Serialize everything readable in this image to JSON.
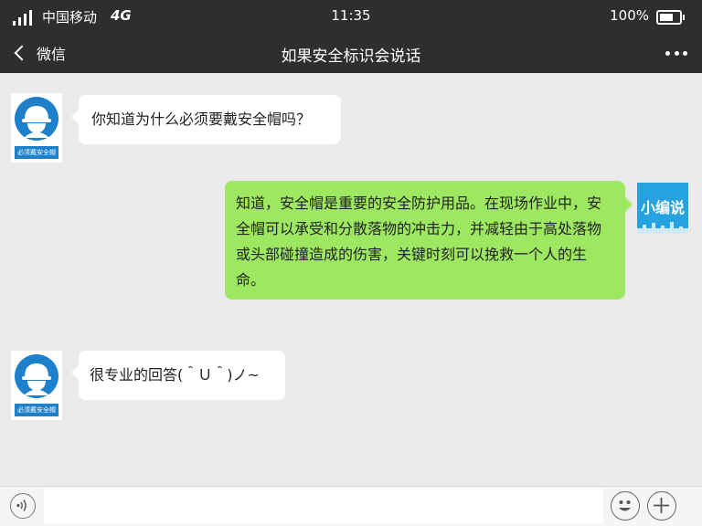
{
  "statusbar": {
    "carrier": "中国移动",
    "network": "4G",
    "time": "11:35",
    "battery": "100%"
  },
  "navbar": {
    "back_label": "微信",
    "title": "如果安全标识会说话"
  },
  "messages": [
    {
      "side": "left",
      "text": "你知道为什么必须要戴安全帽吗？"
    },
    {
      "side": "right",
      "text": "知道，安全帽是重要的安全防护用品。在现场作业中，安全帽可以承受和分散落物的冲击力，并减轻由于高处落物或头部碰撞造成的伤害，关键时刻可以挽救一个人的生命。"
    },
    {
      "side": "left",
      "text": "很专业的回答(＾Ｕ＾)ノ~"
    }
  ],
  "avatars": {
    "left_caption": "必须戴安全帽",
    "right_label": "小编说"
  }
}
